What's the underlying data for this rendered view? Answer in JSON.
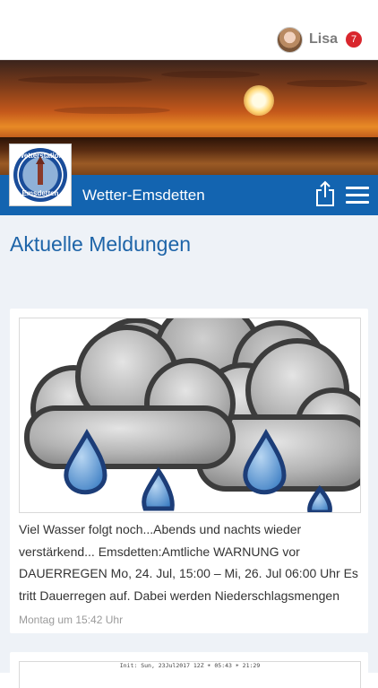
{
  "user": {
    "name": "Lisa",
    "notification_count": "7"
  },
  "navbar": {
    "title": "Wetter-Emsdetten",
    "logo_text_top": "Wetterstation",
    "logo_text_bottom": "Emsdetten"
  },
  "main": {
    "heading": "Aktuelle Meldungen",
    "posts": [
      {
        "image_icon": "rain-clouds-icon",
        "text": "Viel Wasser folgt noch...Abends und nachts wieder verstärkend... Emsdetten:Amtliche WARNUNG vor DAUERREGEN Mo, 24. Jul, 15:00 – Mi, 26. Jul 06:00 Uhr Es tritt Dauerregen auf. Dabei werden Niederschlagsmengen",
        "timestamp": "Montag um 15:42 Uhr"
      },
      {
        "image_caption": "Init: Sun, 23Jul2017 12Z ☀ 05:43 ☀ 21:29"
      }
    ]
  },
  "colors": {
    "brand_blue": "#1364b0",
    "heading_blue": "#1d64a8",
    "badge_red": "#d9262d",
    "background": "#eef2f7"
  }
}
